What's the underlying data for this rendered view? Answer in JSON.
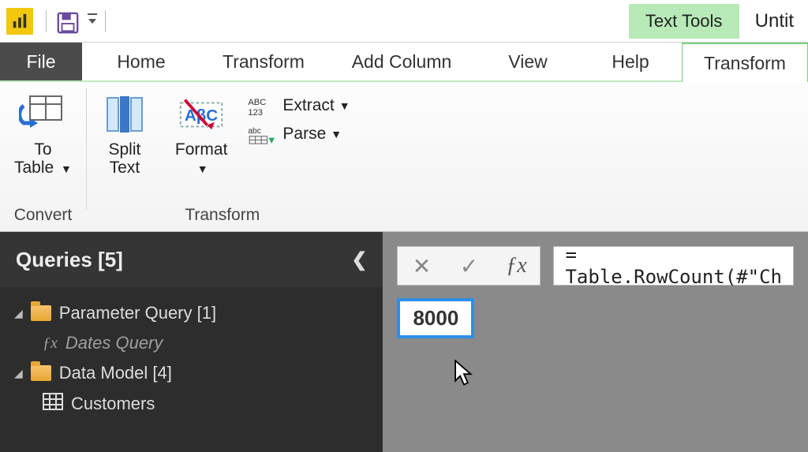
{
  "titlebar": {
    "contextual_label": "Text Tools",
    "doc_title": "Untit"
  },
  "tabs": {
    "file": "File",
    "home": "Home",
    "transform": "Transform",
    "add_column": "Add Column",
    "view": "View",
    "help": "Help",
    "transform_ctx": "Transform"
  },
  "ribbon": {
    "convert": {
      "label": "Convert",
      "to_table": "To\nTable"
    },
    "transform": {
      "label": "Transform",
      "split_text": "Split\nText",
      "format": "Format",
      "extract": "Extract",
      "parse": "Parse"
    }
  },
  "queries": {
    "header": "Queries [5]",
    "items": [
      {
        "type": "folder",
        "label": "Parameter Query [1]"
      },
      {
        "type": "fx",
        "label": "Dates Query"
      },
      {
        "type": "folder",
        "label": "Data Model [4]"
      },
      {
        "type": "table",
        "label": "Customers"
      }
    ]
  },
  "formula": {
    "text": "= Table.RowCount(#\"Ch"
  },
  "result": {
    "value": "8000"
  }
}
